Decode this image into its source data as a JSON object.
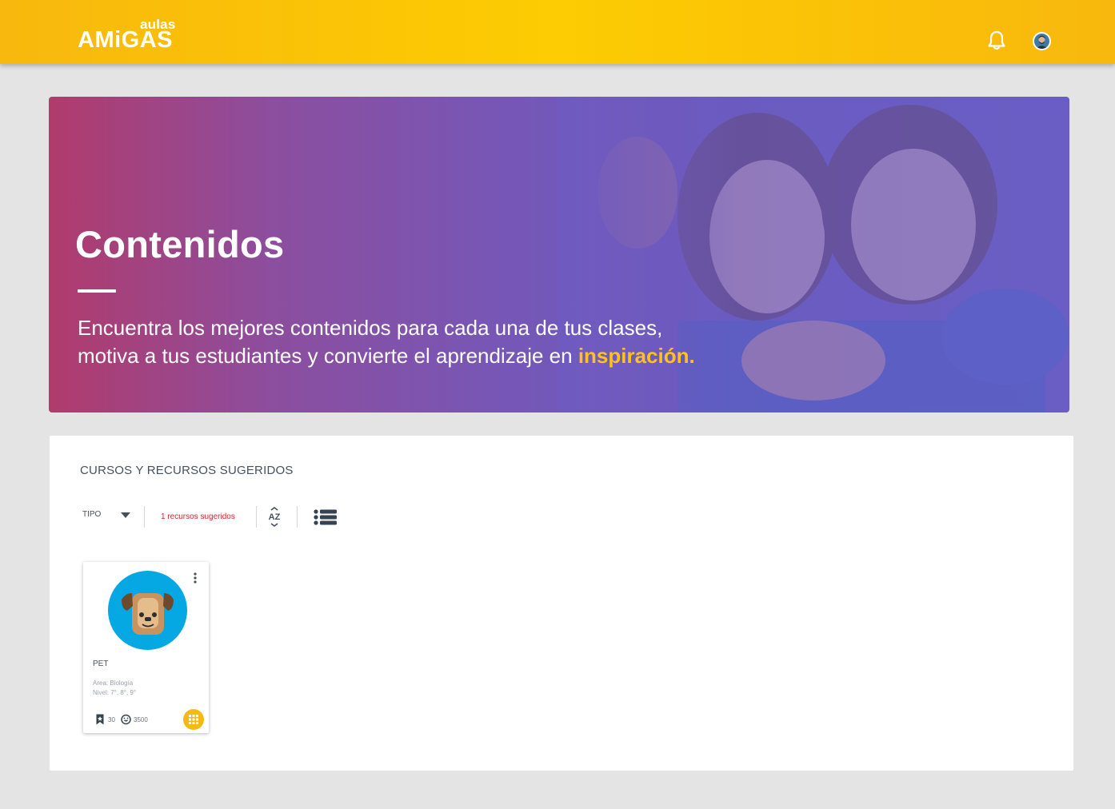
{
  "header": {
    "logo_small": "aulas",
    "logo_big": "AMiGAS",
    "notifications_icon": "bell-icon",
    "avatar_icon": "user-avatar",
    "bar_color": "#fdcc02"
  },
  "hero": {
    "title": "Contenidos",
    "line1": "Encuentra los mejores contenidos para cada una de tus clases,",
    "line2_prefix": "motiva a tus estudiantes y convierte el aprendizaje en ",
    "line2_highlight": "inspiración.",
    "highlight_color": "#fec21c"
  },
  "panel": {
    "title": "CURSOS Y RECURSOS SUGERIDOS",
    "filter_label": "TIPO",
    "result_count": "1 recursos sugeridos",
    "sort_icon": "sort-az-icon",
    "view_icon": "list-view-icon",
    "count_color": "#e0202c"
  },
  "cards": [
    {
      "name": "PET",
      "area": "Area: Biología",
      "level": "Nivel: 7°, 8°, 9°",
      "bookmarks": "30",
      "likes": "3500",
      "image_icon": "dog-face-icon",
      "image_bg": "#05a8e3",
      "action_icon": "grid-apps-icon"
    }
  ]
}
